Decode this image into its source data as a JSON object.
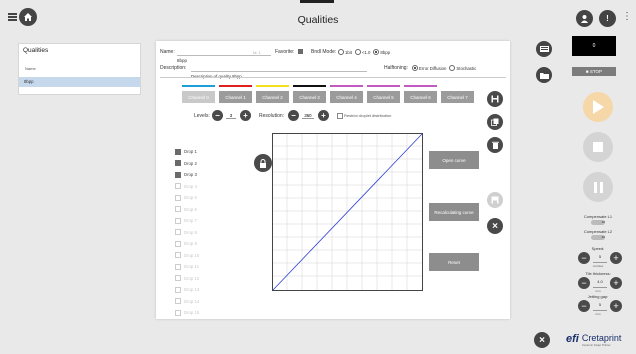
{
  "header": {
    "title": "Qualities",
    "menu_icon": "hamburger-menu-icon",
    "home_icon": "home-icon",
    "user_icon": "user-icon",
    "alert_icon": "exclamation-icon",
    "more_icon": "vertical-dots-icon",
    "alert_glyph": "!",
    "more_glyph": "⋮"
  },
  "sidebar": {
    "heading": "Qualities",
    "column_label": "Name",
    "items": [
      {
        "label": "8bpp",
        "selected": true
      }
    ]
  },
  "form": {
    "name_label": "Name:",
    "name_value": "8bpp",
    "name_id": "Id: 1",
    "favorite_label": "Favorite:",
    "favorite_checked": true,
    "bindi_label": "Bndl Mode:",
    "bindi_options": [
      "1bit",
      "<1.0",
      "8bpp"
    ],
    "bindi_selected": "8bpp",
    "description_label": "Description:",
    "description_value": "Description of quality 8bpp",
    "halftoning_label": "Halftoning:",
    "halftoning_options": [
      "Error Diffusion",
      "Stochastic"
    ],
    "halftoning_selected": "Error Diffusion"
  },
  "channels": [
    {
      "label": "Channel 0",
      "color": "#1e9fd8",
      "active": true
    },
    {
      "label": "Channel 1",
      "color": "#e02020"
    },
    {
      "label": "Channel 2",
      "color": "#f2e21a"
    },
    {
      "label": "Channel 3",
      "color": "#111111"
    },
    {
      "label": "Channel 4",
      "color": "#c15bc1"
    },
    {
      "label": "Channel 5",
      "color": "#c15bc1"
    },
    {
      "label": "Channel 6",
      "color": "#c15bc1"
    },
    {
      "label": "Channel 7",
      "color": "#ffffff"
    }
  ],
  "levels": {
    "label": "Levels:",
    "value": "3",
    "resolution_label": "Resolution:",
    "resolution_value": "360",
    "restrict_label": "Restrict droplet distribution",
    "minus_glyph": "−",
    "plus_glyph": "+"
  },
  "drops": [
    {
      "label": "Drop 1",
      "checked": true,
      "enabled": true
    },
    {
      "label": "Drop 2",
      "checked": true,
      "enabled": true
    },
    {
      "label": "Drop 3",
      "checked": true,
      "enabled": true
    },
    {
      "label": "Drop 4",
      "checked": false,
      "enabled": false
    },
    {
      "label": "Drop 5",
      "checked": false,
      "enabled": false
    },
    {
      "label": "Drop 6",
      "checked": false,
      "enabled": false
    },
    {
      "label": "Drop 7",
      "checked": false,
      "enabled": false
    },
    {
      "label": "Drop 8",
      "checked": false,
      "enabled": false
    },
    {
      "label": "Drop 9",
      "checked": false,
      "enabled": false
    },
    {
      "label": "Drop 10",
      "checked": false,
      "enabled": false
    },
    {
      "label": "Drop 11",
      "checked": false,
      "enabled": false
    },
    {
      "label": "Drop 12",
      "checked": false,
      "enabled": false
    },
    {
      "label": "Drop 13",
      "checked": false,
      "enabled": false
    },
    {
      "label": "Drop 14",
      "checked": false,
      "enabled": false
    },
    {
      "label": "Drop 15",
      "checked": false,
      "enabled": false
    }
  ],
  "curve_buttons": {
    "open": "Open curve",
    "recalc": "Recalculating curve",
    "reset": "Reset"
  },
  "right_panel": {
    "counter": "0",
    "stop_label": "■ STOP",
    "compensate_l1": "Compensate L1",
    "compensate_l1_value": "20",
    "compensate_l2": "Compensate L2",
    "compensate_l2_value": "20",
    "speed_label": "Speed:",
    "speed_value": "5",
    "speed_unit": "mm/sec",
    "tile_label": "Tile thickness:",
    "tile_value": "4.0",
    "tile_unit": "mm",
    "jetting_label": "Jetting gap:",
    "jetting_value": "5",
    "jetting_unit": "mm"
  },
  "brand": {
    "logo_text": "efi",
    "product": "Cretaprint",
    "tagline": "Ceramic Inkjet Printer"
  },
  "colors": {
    "accent": "#c5d8ec",
    "play_disabled": "#f5d7a8",
    "line": "#2d3fd6"
  }
}
